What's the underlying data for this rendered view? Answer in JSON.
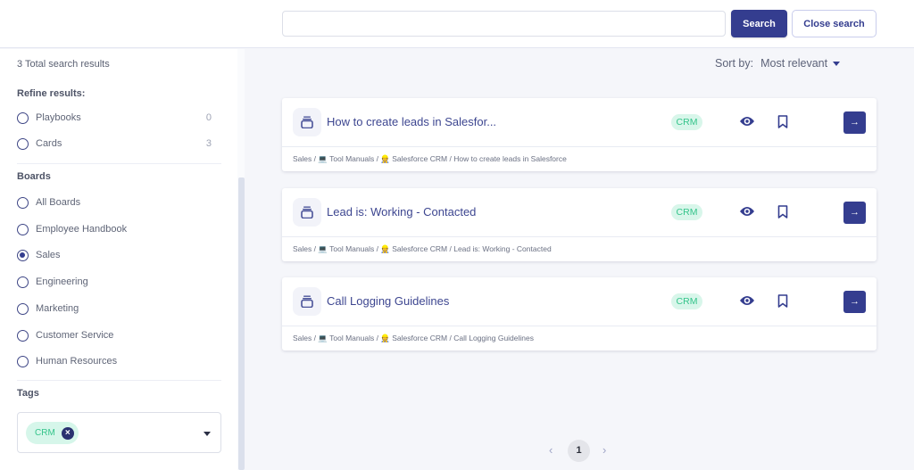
{
  "search": {
    "query": "",
    "placeholder": "",
    "search_label": "Search",
    "close_label": "Close search"
  },
  "sidebar": {
    "total_results": "3 Total search results",
    "refine_title": "Refine results:",
    "refine_options": [
      {
        "label": "Playbooks",
        "count": "0",
        "checked": false
      },
      {
        "label": "Cards",
        "count": "3",
        "checked": false
      }
    ],
    "boards_title": "Boards",
    "boards": [
      {
        "label": "All Boards",
        "checked": false
      },
      {
        "label": "Employee Handbook",
        "checked": false
      },
      {
        "label": "Sales",
        "checked": true
      },
      {
        "label": "Engineering",
        "checked": false
      },
      {
        "label": "Marketing",
        "checked": false
      },
      {
        "label": "Customer Service",
        "checked": false
      },
      {
        "label": "Human Resources",
        "checked": false
      }
    ],
    "tags_title": "Tags",
    "selected_tags": [
      {
        "label": "CRM",
        "remove_icon": "close-circle-icon"
      }
    ]
  },
  "sort": {
    "label": "Sort by:",
    "value": "Most relevant"
  },
  "results": [
    {
      "title": "How to create leads in Salesfor...",
      "tag": "CRM",
      "icon": "card-stack-icon",
      "path": "Sales / 💻 Tool Manuals / 👷 Salesforce CRM / How to create leads in Salesforce"
    },
    {
      "title": "Lead is: Working - Contacted",
      "tag": "CRM",
      "icon": "card-stack-icon",
      "path": "Sales / 💻 Tool Manuals / 👷 Salesforce CRM / Lead is: Working - Contacted"
    },
    {
      "title": "Call Logging Guidelines",
      "tag": "CRM",
      "icon": "card-stack-icon",
      "path": "Sales / 💻 Tool Manuals / 👷 Salesforce CRM / Call Logging Guidelines"
    }
  ],
  "pagination": {
    "prev": "‹",
    "current": "1",
    "next": "›"
  },
  "colors": {
    "primary": "#343d8f",
    "tag_bg": "#d8f6ea",
    "tag_text": "#35c48b",
    "page_bg": "#f5f6fa"
  }
}
